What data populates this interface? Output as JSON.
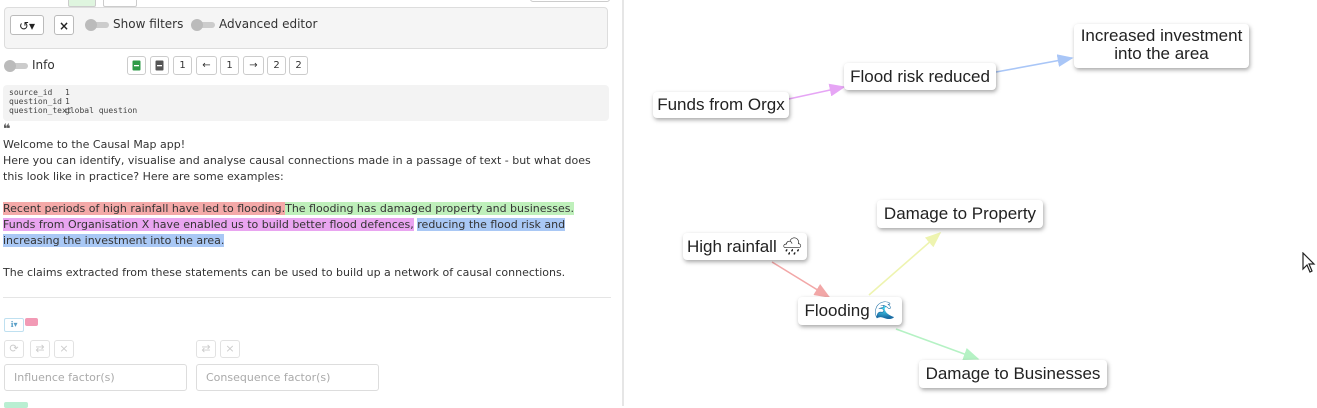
{
  "toolbar": {
    "undo_label": "↺▾",
    "close_label": "×",
    "show_filters_label": "Show filters",
    "advanced_editor_label": "Advanced editor"
  },
  "info": {
    "toggle_label": "Info"
  },
  "pager": {
    "current_label": "1",
    "prev_label": "←",
    "page_label": "1",
    "next_label": "→",
    "last_label": "2",
    "total_label": "2"
  },
  "meta": {
    "rows": [
      {
        "key": "source_id",
        "value": "1"
      },
      {
        "key": "question_id",
        "value": "1"
      },
      {
        "key": "question_text",
        "value": "global question"
      }
    ]
  },
  "statement": {
    "quote_icon": "❝",
    "intro_1": "Welcome to the Causal Map app!",
    "intro_2": "Here you can identify, visualise and analyse causal connections made in a passage of text - but what does this look like in practice?  Here are some examples:",
    "hl_1": "Recent periods of high rainfall have led to flooding.",
    "hl_2": "The flooding has damaged property and businesses.",
    "hl_3": "Funds from Organisation X have enabled us to build better flood defences,",
    "hl_4": "reducing the flood risk and increasing the investment into the area.",
    "outro": "The claims extracted from these statements can be used to build up a network of causal connections."
  },
  "coding": {
    "influence_placeholder": "Influence factor(s)",
    "consequence_placeholder": "Consequence factor(s)"
  },
  "graph": {
    "nodes": {
      "funds": "Funds from Orgx",
      "flood_risk": "Flood risk reduced",
      "investment": "Increased investment into the area",
      "damage_property": "Damage to Property",
      "high_rainfall": "High rainfall 🌧",
      "flooding": "Flooding 🌊",
      "damage_business": "Damage to Businesses"
    },
    "edge_colors": {
      "funds_to_risk": "#e6a5f5",
      "risk_to_investment": "#a9c6f7",
      "rain_to_flood": "#f2a7a7",
      "flood_to_property": "#eef4b0",
      "flood_to_business": "#b5f2c4"
    }
  }
}
